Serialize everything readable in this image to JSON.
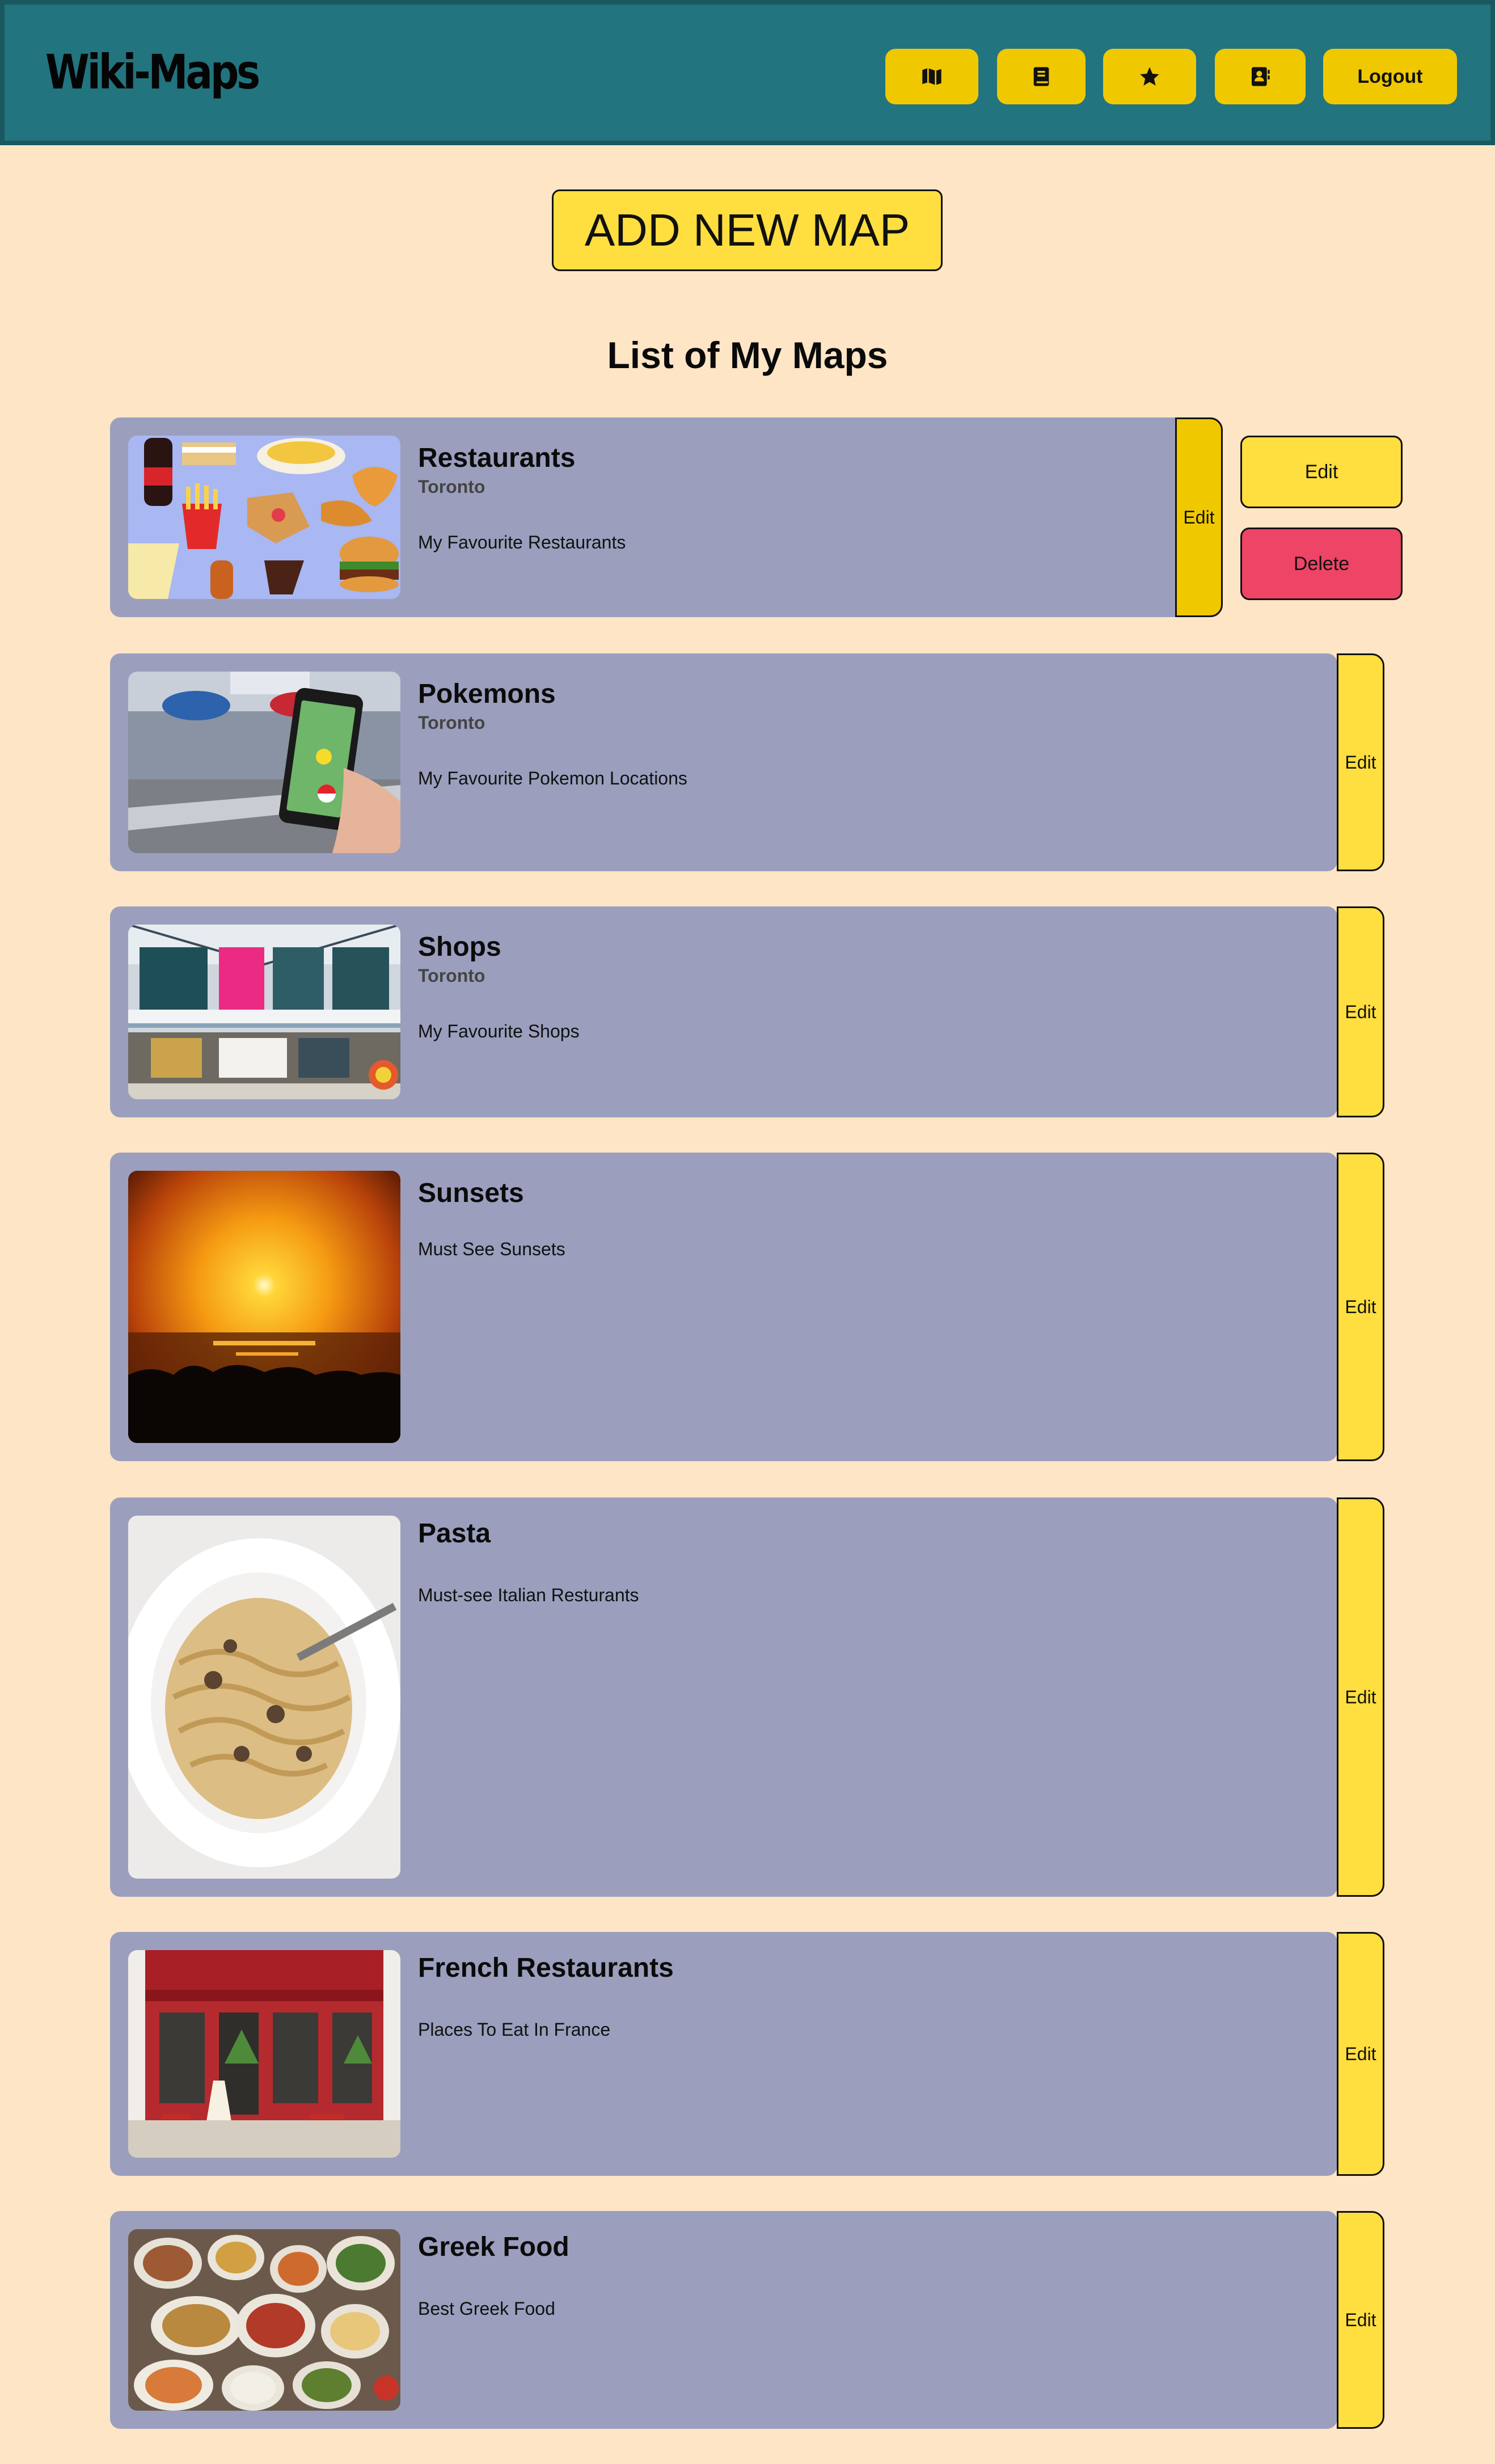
{
  "header": {
    "brand": "Wiki-Maps",
    "nav": [
      {
        "icon": "map-icon"
      },
      {
        "icon": "book-icon"
      },
      {
        "icon": "star-icon"
      },
      {
        "icon": "contact-book-icon"
      }
    ],
    "logout_label": "Logout"
  },
  "main": {
    "add_map_label": "ADD NEW MAP",
    "list_title": "List of My Maps",
    "edit_label": "Edit",
    "maps": [
      {
        "title": "Restaurants",
        "city": "Toronto",
        "description": "My Favourite Restaurants",
        "image": "fast-food-collage"
      },
      {
        "title": "Pokemons",
        "city": "Toronto",
        "description": "My Favourite Pokemon Locations",
        "image": "phone-pokemon-go"
      },
      {
        "title": "Shops",
        "city": "Toronto",
        "description": "My Favourite Shops",
        "image": "shopping-mall"
      },
      {
        "title": "Sunsets",
        "description": "Must See Sunsets",
        "image": "sunset-over-sea"
      },
      {
        "title": "Pasta",
        "description": "Must-see Italian Resturants",
        "image": "plate-of-pasta"
      },
      {
        "title": "French Restaurants",
        "description": "Places To Eat In France",
        "image": "french-cafe"
      },
      {
        "title": "Greek Food",
        "description": "Best Greek Food",
        "image": "greek-food-spread"
      }
    ],
    "actions": {
      "edit_label": "Edit",
      "delete_label": "Delete"
    }
  },
  "colors": {
    "background": "#fde5c6",
    "header": "#22747f",
    "accent": "#f0c800",
    "card": "#9b9fbd",
    "delete": "#ee4466"
  }
}
